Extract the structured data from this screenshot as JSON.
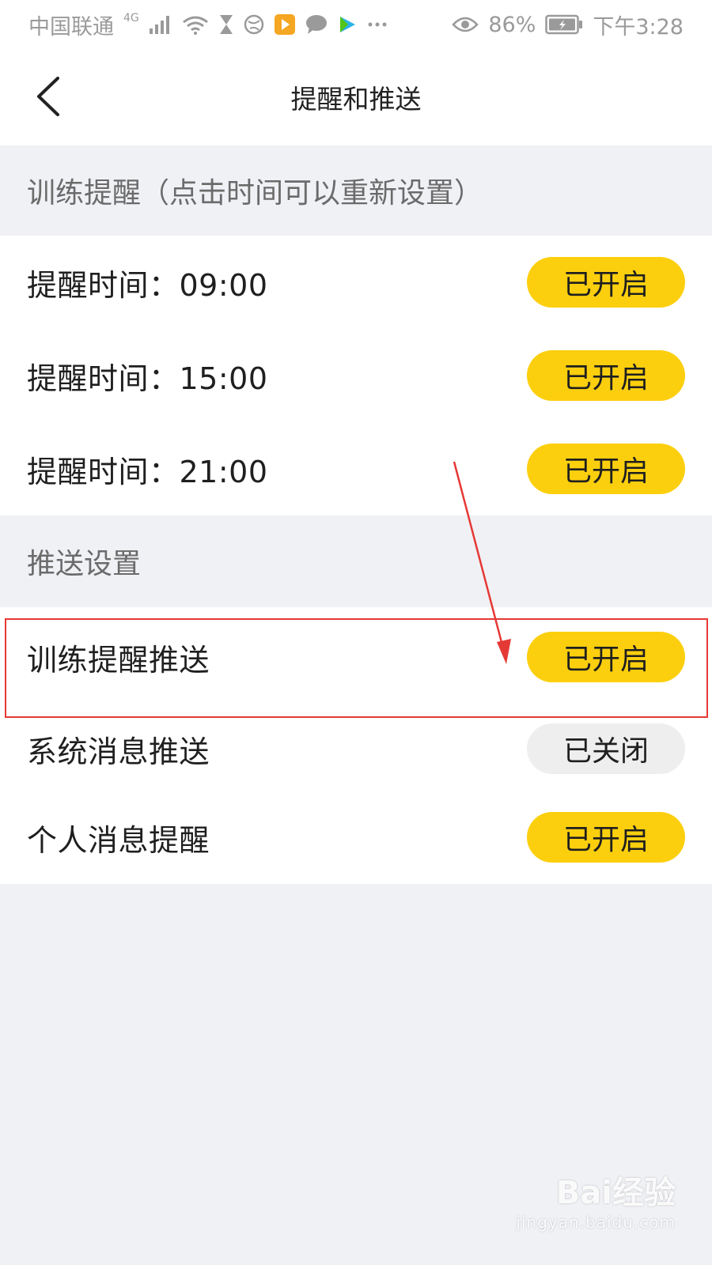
{
  "status_bar": {
    "carrier": "中国联通",
    "network": "4G",
    "battery": "86%",
    "time": "下午3:28"
  },
  "nav": {
    "title": "提醒和推送"
  },
  "training_reminder": {
    "header": "训练提醒（点击时间可以重新设置）",
    "items": [
      {
        "label": "提醒时间：09:00",
        "status": "已开启",
        "on": true
      },
      {
        "label": "提醒时间：15:00",
        "status": "已开启",
        "on": true
      },
      {
        "label": "提醒时间：21:00",
        "status": "已开启",
        "on": true
      }
    ]
  },
  "push_settings": {
    "header": "推送设置",
    "items": [
      {
        "label": "训练提醒推送",
        "status": "已开启",
        "on": true
      },
      {
        "label": "系统消息推送",
        "status": "已关闭",
        "on": false
      },
      {
        "label": "个人消息提醒",
        "status": "已开启",
        "on": true
      }
    ]
  },
  "watermark": {
    "logo": "Bai经验",
    "url": "jingyan.baidu.com"
  },
  "colors": {
    "pill_on": "#fccf0e",
    "pill_off": "#eeeeee",
    "annotation": "#e53935",
    "section_bg": "#f0f1f5"
  }
}
